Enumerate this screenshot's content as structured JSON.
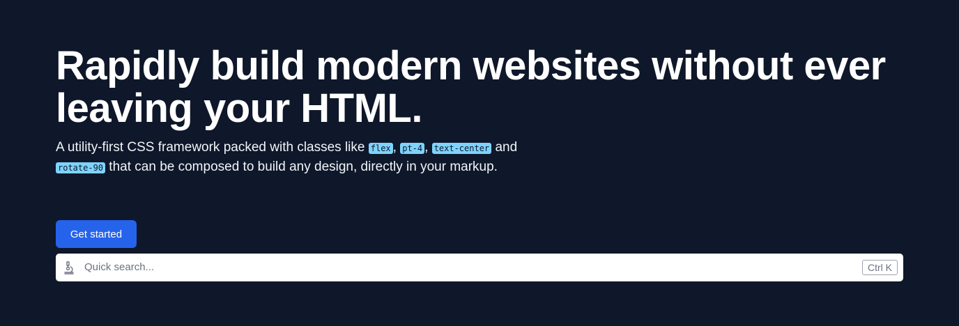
{
  "hero": {
    "headline": "Rapidly build modern websites without ever leaving your HTML.",
    "lead": {
      "text_1": "A utility-first CSS framework packed with classes like ",
      "chips": [
        "flex",
        "pt-4",
        "text-center",
        "rotate-90"
      ],
      "sep_1": ", ",
      "sep_2": ", ",
      "text_2": " and ",
      "text_3": " that can be composed to build any design, directly in your markup."
    }
  },
  "cta": {
    "label": "Get started"
  },
  "search": {
    "placeholder": "Quick search...",
    "shortcut": "Ctrl K",
    "icon": "microscope-icon"
  },
  "colors": {
    "background": "#0f172a",
    "accent": "#2563eb",
    "chip": "#7dd3fc"
  }
}
